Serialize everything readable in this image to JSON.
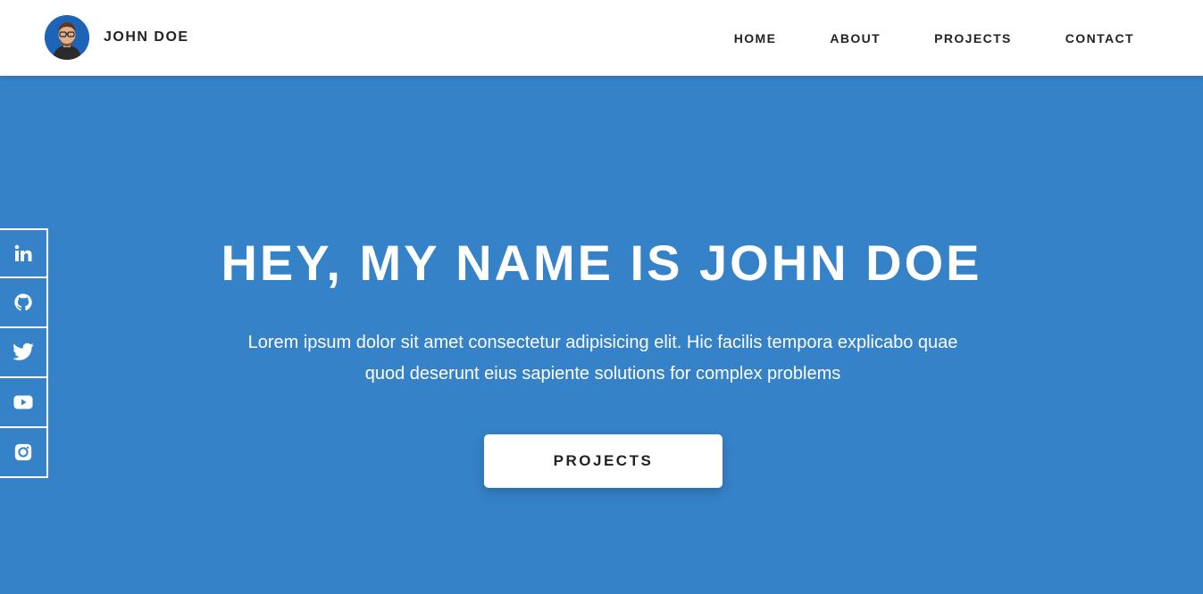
{
  "header": {
    "brand_name": "JOHN DOE",
    "nav": [
      {
        "label": "HOME"
      },
      {
        "label": "ABOUT"
      },
      {
        "label": "PROJECTS"
      },
      {
        "label": "CONTACT"
      }
    ]
  },
  "hero": {
    "title": "HEY, MY NAME IS JOHN DOE",
    "description": "Lorem ipsum dolor sit amet consectetur adipisicing elit. Hic facilis tempora explicabo quae quod deserunt eius sapiente solutions for complex problems",
    "button_label": "PROJECTS"
  },
  "social": [
    {
      "icon": "linkedin-icon"
    },
    {
      "icon": "github-icon"
    },
    {
      "icon": "twitter-icon"
    },
    {
      "icon": "youtube-icon"
    },
    {
      "icon": "instagram-icon"
    }
  ],
  "colors": {
    "hero_background": "#3582c8",
    "header_background": "#ffffff",
    "text_dark": "#222222",
    "text_light": "#ffffff"
  }
}
